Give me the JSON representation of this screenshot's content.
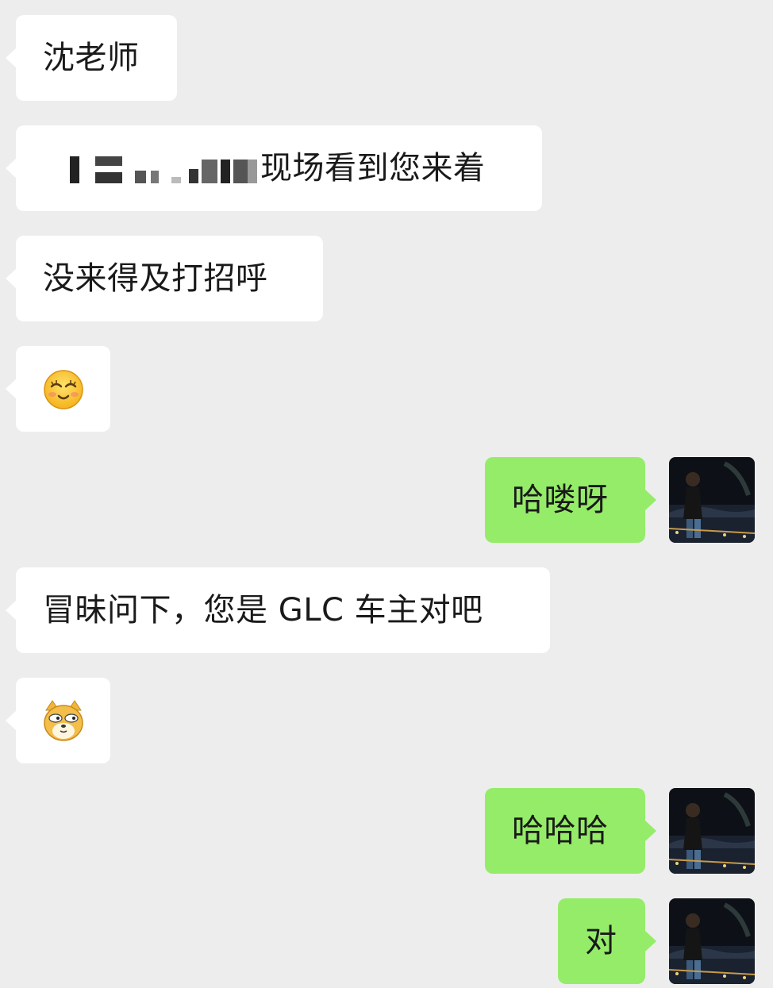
{
  "messages": [
    {
      "side": "in",
      "text": "沈老师"
    },
    {
      "side": "in",
      "text": "现场看到您来着",
      "redacted_prefix": true
    },
    {
      "side": "in",
      "text": "没来得及打招呼"
    },
    {
      "side": "in",
      "emoji": "shy-smile-emoji"
    },
    {
      "side": "out",
      "text": "哈喽呀",
      "avatar": "user-avatar"
    },
    {
      "side": "in",
      "text": "冒昧问下，您是 GLC 车主对吧"
    },
    {
      "side": "in",
      "emoji": "doge-emoji"
    },
    {
      "side": "out",
      "text": "哈哈哈",
      "avatar": "user-avatar"
    },
    {
      "side": "out",
      "text": "对",
      "avatar": "user-avatar"
    }
  ],
  "colors": {
    "background": "#ededed",
    "incoming_bubble": "#ffffff",
    "outgoing_bubble": "#95ec69",
    "text": "#1a1a1a"
  }
}
